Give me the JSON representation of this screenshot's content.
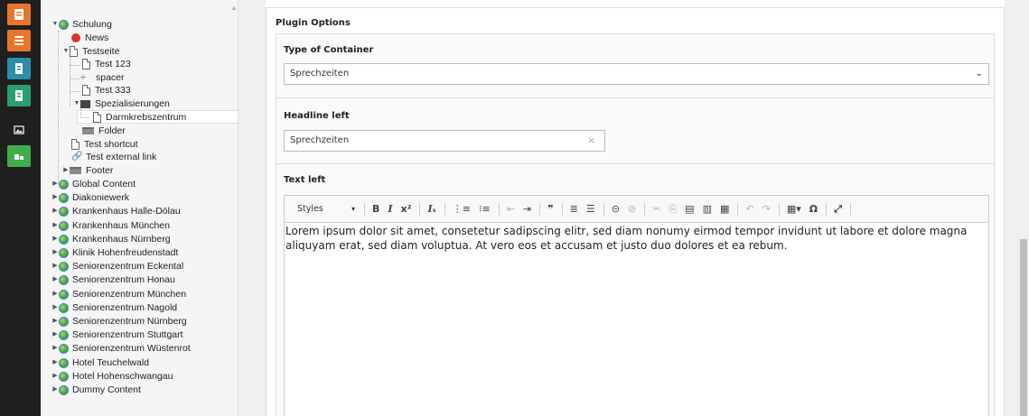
{
  "modules": [
    {
      "name": "page-module",
      "color": "#e8752a"
    },
    {
      "name": "list-module",
      "color": "#e8752a"
    },
    {
      "name": "info-module",
      "color": "#2a8fa8"
    },
    {
      "name": "view-module",
      "color": "#2a9e6e"
    },
    {
      "name": "filelist-module",
      "color": "#1f1f1f"
    },
    {
      "name": "extension-module",
      "color": "#3fae49"
    }
  ],
  "tree": {
    "root": "Schulung",
    "news": "News",
    "testseite": "Testseite",
    "test123": "Test 123",
    "spacer": "spacer",
    "test333": "Test 333",
    "spezialisierungen": "Spezialisierungen",
    "darmkrebszentrum": "Darmkrebszentrum",
    "folder": "Folder",
    "test_shortcut": "Test shortcut",
    "test_external_link": "Test external link",
    "footer": "Footer",
    "sites": [
      "Global Content",
      "Diakoniewerk",
      "Krankenhaus Halle-Dölau",
      "Krankenhaus München",
      "Krankenhaus Nürnberg",
      "Klinik Hohenfreudenstadt",
      "Seniorenzentrum Eckental",
      "Seniorenzentrum Honau",
      "Seniorenzentrum München",
      "Seniorenzentrum Nagold",
      "Seniorenzentrum Nürnberg",
      "Seniorenzentrum Stuttgart",
      "Seniorenzentrum Wüstenrot",
      "Hotel Teuchelwald",
      "Hotel Hohenschwangau",
      "Dummy Content"
    ]
  },
  "form": {
    "plugin_options": "Plugin Options",
    "type_label": "Type of Container",
    "type_value": "Sprechzeiten",
    "headline_label": "Headline left",
    "headline_value": "Sprechzeiten",
    "text_label": "Text left",
    "styles": "Styles",
    "text_value": "Lorem ipsum dolor sit amet, consetetur sadipscing elitr, sed diam nonumy eirmod tempor invidunt ut labore et dolore magna aliquyam erat, sed diam voluptua. At vero eos et accusam et justo duo dolores et ea rebum."
  }
}
